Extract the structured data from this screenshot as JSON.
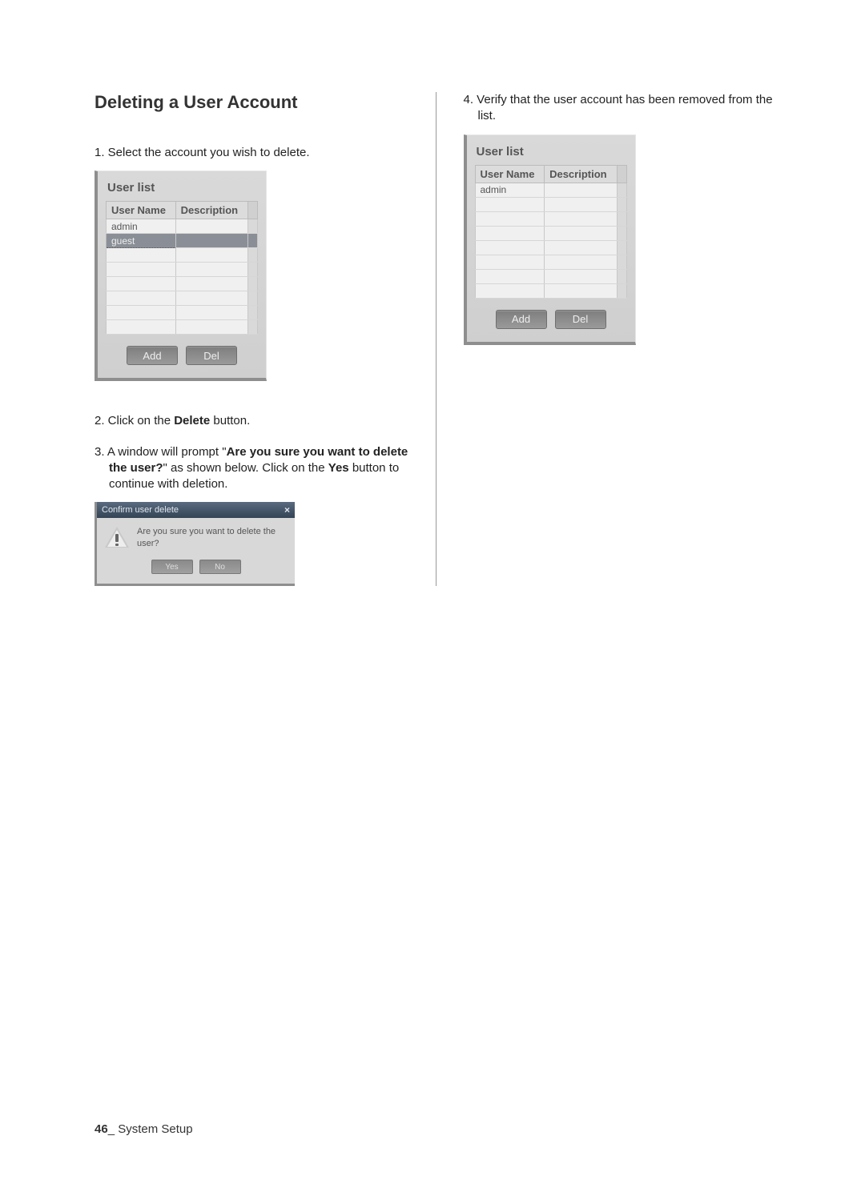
{
  "section_title": "Deleting a User Account",
  "steps": {
    "s1": "1. Select the account you wish to delete.",
    "s2_pre": "2. Click on the ",
    "s2_bold": "Delete",
    "s2_post": " button.",
    "s3_pre": "3. A window will prompt \"",
    "s3_bold1": "Are you sure you want to delete the user?",
    "s3_mid": "\" as shown below. Click on the ",
    "s3_bold2": "Yes",
    "s3_post": " button to continue with deletion.",
    "s4": "4. Verify that the user account has been removed from the list."
  },
  "userlist": {
    "title": "User list",
    "col_user": "User Name",
    "col_desc": "Description",
    "btn_add": "Add",
    "btn_del": "Del",
    "panel1_rows": [
      {
        "user": "admin",
        "desc": ""
      },
      {
        "user": "guest",
        "desc": "",
        "selected": true
      },
      {
        "user": "",
        "desc": ""
      },
      {
        "user": "",
        "desc": ""
      },
      {
        "user": "",
        "desc": ""
      },
      {
        "user": "",
        "desc": ""
      },
      {
        "user": "",
        "desc": ""
      },
      {
        "user": "",
        "desc": ""
      }
    ],
    "panel2_rows": [
      {
        "user": "admin",
        "desc": ""
      },
      {
        "user": "",
        "desc": ""
      },
      {
        "user": "",
        "desc": ""
      },
      {
        "user": "",
        "desc": ""
      },
      {
        "user": "",
        "desc": ""
      },
      {
        "user": "",
        "desc": ""
      },
      {
        "user": "",
        "desc": ""
      },
      {
        "user": "",
        "desc": ""
      }
    ]
  },
  "dialog": {
    "title": "Confirm user delete",
    "close": "×",
    "message": "Are you sure you want to delete the user?",
    "btn_yes": "Yes",
    "btn_no": "No"
  },
  "footer": {
    "page": "46",
    "sep": "_",
    "section": " System Setup"
  }
}
